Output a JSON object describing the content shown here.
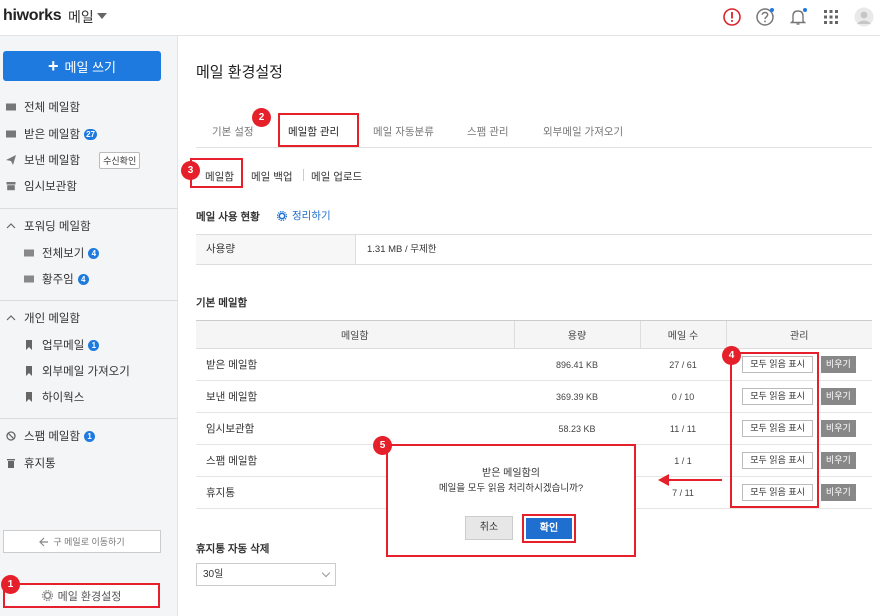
{
  "topbar": {
    "brand": "hiworks",
    "app": "메일"
  },
  "sidebar": {
    "compose_label": "메일 쓰기",
    "items": [
      {
        "label": "전체 메일함",
        "icon": "mail-icon"
      },
      {
        "label": "받은 메일함",
        "badge": "27",
        "icon": "inbox-icon"
      },
      {
        "label": "보낸 메일함",
        "chip": "수신확인",
        "icon": "send-icon"
      },
      {
        "label": "임시보관함",
        "icon": "archive-icon"
      }
    ],
    "forward_group": "포워딩 메일함",
    "forward_items": [
      {
        "label": "전체보기",
        "badge": "4"
      },
      {
        "label": "황주임",
        "badge": "4"
      }
    ],
    "personal_group": "개인 메일함",
    "personal_items": [
      {
        "label": "업무메일",
        "badge": "1"
      },
      {
        "label": "외부메일 가져오기"
      },
      {
        "label": "하이웍스"
      }
    ],
    "spam": {
      "label": "스팸 메일함",
      "badge": "1"
    },
    "trash": {
      "label": "휴지통"
    },
    "old_mail": "구 메일로 이동하기",
    "settings": "메일 환경설정"
  },
  "main": {
    "title": "메일 환경설정",
    "tabs": [
      "기본 설정",
      "메일함 관리",
      "메일 자동분류",
      "스팸 관리",
      "외부메일 가져오기"
    ],
    "subtabs": [
      "메일함",
      "메일 백업",
      "메일 업로드"
    ],
    "usage_title": "메일 사용 현황",
    "cleanup": "정리하기",
    "usage_label": "사용량",
    "usage_value": "1.31 MB / 무제한",
    "basic_title": "기본 메일함",
    "columns": [
      "메일함",
      "용량",
      "메일 수",
      "관리"
    ],
    "rows": [
      {
        "name": "받은 메일함",
        "size": "896.41 KB",
        "count": "27 / 61"
      },
      {
        "name": "보낸 메일함",
        "size": "369.39 KB",
        "count": "0 / 10"
      },
      {
        "name": "임시보관함",
        "size": "58.23 KB",
        "count": "11 / 11"
      },
      {
        "name": "스팸 메일함",
        "size": "",
        "count": "1 / 1"
      },
      {
        "name": "휴지통",
        "size": "",
        "count": "7 / 11"
      }
    ],
    "read_all": "모두 읽음 표시",
    "empty": "비우기",
    "auto_delete_title": "휴지통 자동 삭제",
    "auto_delete_value": "30일"
  },
  "dialog": {
    "line1": "받은 메일함의",
    "line2": "메일을 모두 읽음 처리하시겠습니까?",
    "cancel": "취소",
    "ok": "확인"
  },
  "markers": [
    "1",
    "2",
    "3",
    "4",
    "5"
  ],
  "colors": {
    "accent": "#1f7ae0",
    "highlight": "#e5202a",
    "alert": "#d9262e"
  }
}
